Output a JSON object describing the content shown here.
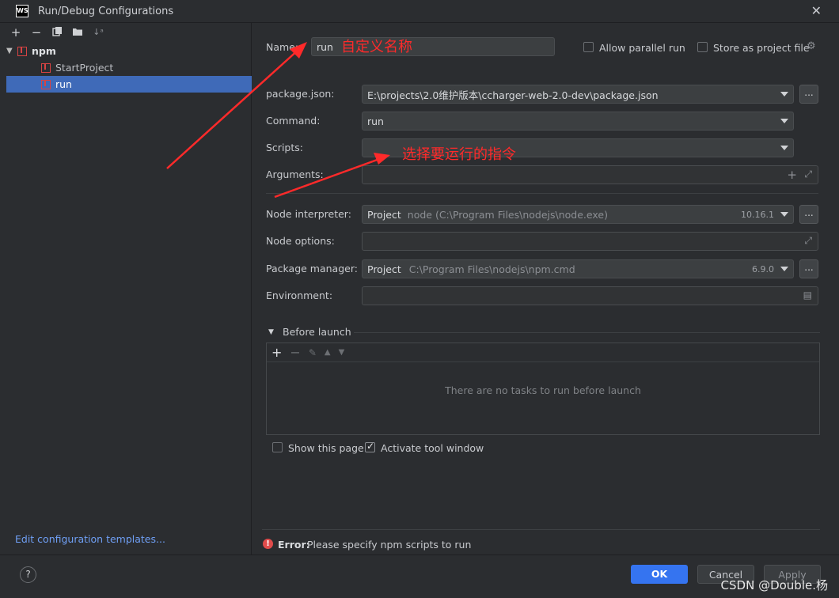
{
  "window": {
    "title": "Run/Debug Configurations",
    "logo": "WS"
  },
  "left_toolbar": {
    "icons": [
      "add-icon",
      "remove-icon",
      "copy-icon",
      "folder-icon",
      "sort-icon"
    ]
  },
  "tree": {
    "group": "npm",
    "items": [
      "StartProject",
      "run"
    ],
    "selected": "run"
  },
  "edit_templates_link": "Edit configuration templates...",
  "form": {
    "name_label": "Name:",
    "name_value": "run",
    "allow_parallel_label": "Allow parallel run",
    "store_project_label": "Store as project file",
    "package_json_label": "package.json:",
    "package_json_value": "E:\\projects\\2.0维护版本\\ccharger-web-2.0-dev\\package.json",
    "command_label": "Command:",
    "command_value": "run",
    "scripts_label": "Scripts:",
    "scripts_value": "",
    "arguments_label": "Arguments:",
    "node_interpreter_label": "Node interpreter:",
    "node_interpreter_prefix": "Project",
    "node_interpreter_value": "node (C:\\Program Files\\nodejs\\node.exe)",
    "node_version": "10.16.1",
    "node_options_label": "Node options:",
    "package_manager_label": "Package manager:",
    "package_manager_prefix": "Project",
    "package_manager_value": "C:\\Program Files\\nodejs\\npm.cmd",
    "package_manager_version": "6.9.0",
    "environment_label": "Environment:",
    "browse": "..."
  },
  "before_launch": {
    "title": "Before launch",
    "empty_text": "There are no tasks to run before launch"
  },
  "options": {
    "show_page_label": "Show this page",
    "show_page_checked": false,
    "activate_window_label": "Activate tool window",
    "activate_window_checked": true
  },
  "error": {
    "prefix": "Error:",
    "message": "Please specify npm scripts to run"
  },
  "annotations": {
    "name_note": "自定义名称",
    "scripts_note": "选择要运行的指令",
    "color": "#ff2a2a"
  },
  "footer": {
    "ok": "OK",
    "cancel": "Cancel",
    "apply": "Apply",
    "help": "?",
    "watermark": "CSDN @Double.杨"
  },
  "colors": {
    "accent": "#3574f0",
    "selection": "#3f6ab8",
    "error": "#e04b4b",
    "link": "#6f9ff5"
  }
}
